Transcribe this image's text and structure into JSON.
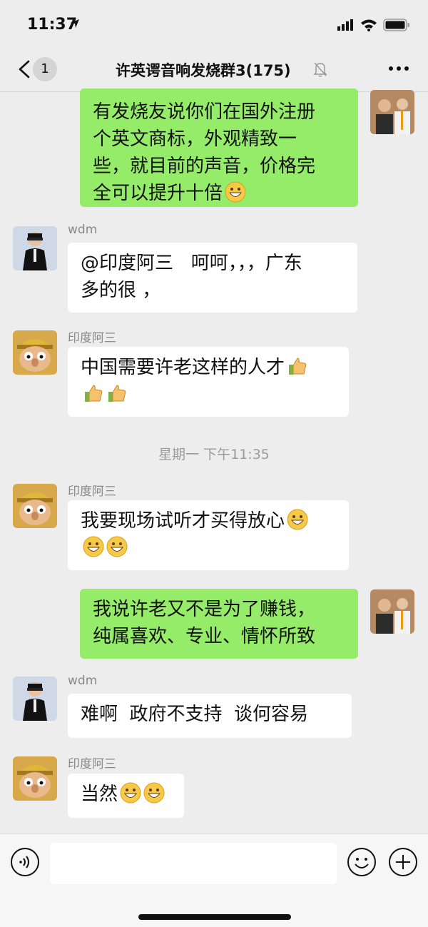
{
  "status_bar": {
    "time": "11:37"
  },
  "nav": {
    "unread_count": "1",
    "title": "许英谔音响发烧群3(175)"
  },
  "messages": [
    {
      "side": "out",
      "text": "有发烧友说你们在国外注册\n个英文商标，外观精致一\n些，就目前的声音，价格完\n全可以提升十倍",
      "emoji": [
        "grin"
      ]
    },
    {
      "side": "in",
      "sender": "wdm",
      "text": "@印度阿三   呵呵，，，广东\n多的很 ，",
      "emoji": []
    },
    {
      "side": "in",
      "sender": "印度阿三",
      "text": "中国需要许老这样的人才",
      "emoji": [
        "thumbs-up",
        "thumbs-up",
        "thumbs-up"
      ]
    },
    {
      "side": "in",
      "sender": "印度阿三",
      "text": "我要现场试听才买得放心",
      "emoji": [
        "grin",
        "grin",
        "grin"
      ]
    },
    {
      "side": "out",
      "text": "我说许老又不是为了赚钱，\n纯属喜欢、专业、情怀所致",
      "emoji": []
    },
    {
      "side": "in",
      "sender": "wdm",
      "text": "难啊  政府不支持  谈何容易",
      "emoji": []
    },
    {
      "side": "in",
      "sender": "印度阿三",
      "text": "当然",
      "emoji": [
        "grin",
        "grin"
      ]
    }
  ],
  "timestamp": "星期一 下午11:35",
  "colors": {
    "outgoing_bubble": "#95ec69",
    "incoming_bubble": "#ffffff",
    "background": "#ededed"
  },
  "icons": [
    "location-arrow-icon",
    "signal-icon",
    "wifi-icon",
    "battery-icon",
    "back-chevron-icon",
    "mute-bell-icon",
    "more-dots-icon",
    "voice-icon",
    "emoji-face-icon",
    "plus-icon"
  ]
}
